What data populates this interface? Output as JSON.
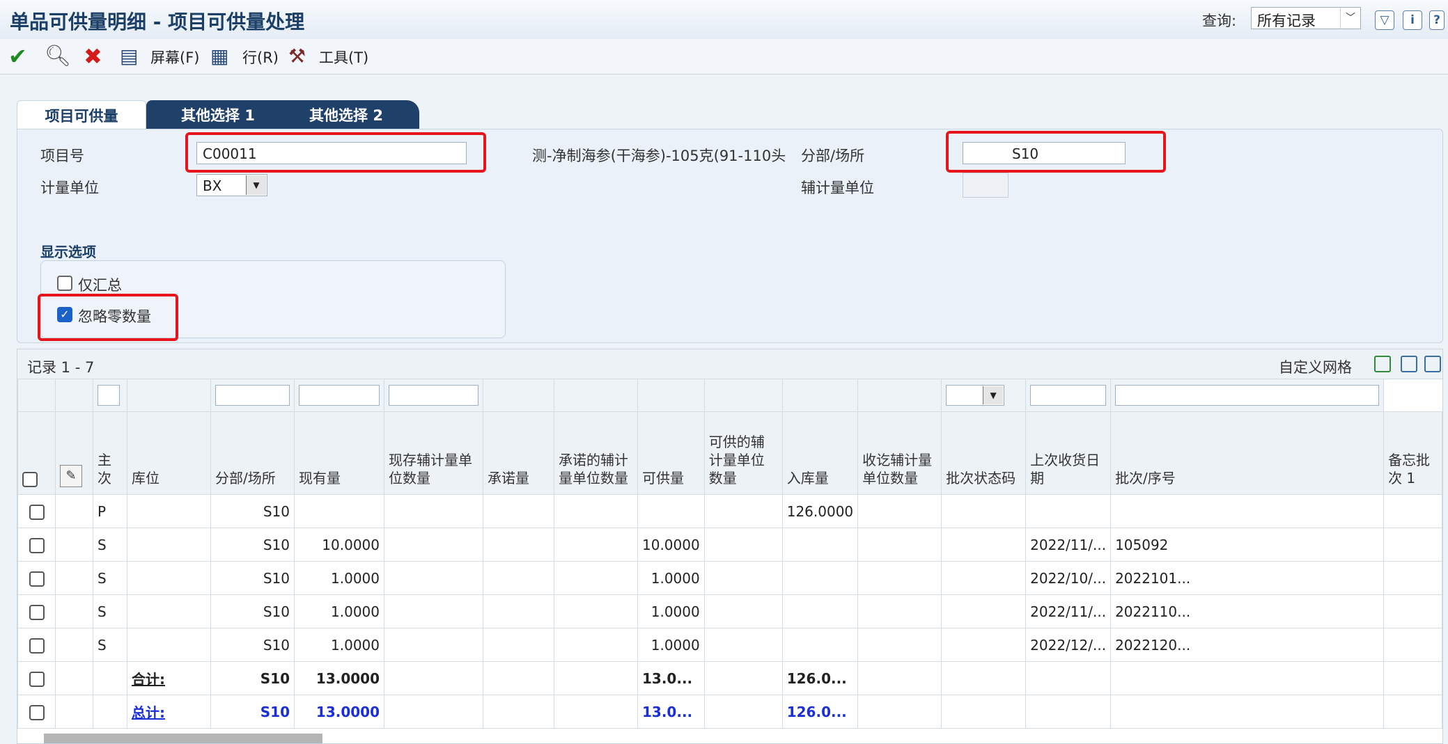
{
  "header": {
    "title": "单品可供量明细 - 项目可供量处理",
    "query_label": "查询:",
    "query_value": "所有记录"
  },
  "toolbar": {
    "screen_label": "屏幕(F)",
    "row_label": "行(R)",
    "tools_label": "工具(T)"
  },
  "tabs": [
    "项目可供量",
    "其他选择 1",
    "其他选择 2"
  ],
  "form": {
    "item_no_label": "项目号",
    "item_no_value": "C00011",
    "item_desc": "测-净制海参(干海参)-105克(91-110头",
    "uom_label": "计量单位",
    "uom_value": "BX",
    "branch_label": "分部/场所",
    "branch_value": "S10",
    "sec_uom_label": "辅计量单位",
    "display_options_title": "显示选项",
    "summary_only_label": "仅汇总",
    "summary_only_checked": false,
    "ignore_zero_label": "忽略零数量",
    "ignore_zero_checked": true
  },
  "grid": {
    "records_label": "记录 1 - 7",
    "custom_grid_label": "自定义网格",
    "columns": [
      "主次",
      "库位",
      "分部/场所",
      "现有量",
      "现存辅计量单位数量",
      "承诺量",
      "承诺的辅计量单位数量",
      "可供量",
      "可供的辅计量单位数量",
      "入库量",
      "收讫辅计量单位数量",
      "批次状态码",
      "上次收货日期",
      "批次/序号",
      "备忘批次 1"
    ],
    "rows": [
      {
        "type": "P",
        "loc": "",
        "branch": "S10",
        "onhand": "",
        "committed": "",
        "avail": "",
        "inbound": "126.0000",
        "lastdate": "",
        "lot": ""
      },
      {
        "type": "S",
        "loc": "",
        "branch": "S10",
        "onhand": "10.0000",
        "committed": "",
        "avail": "10.0000",
        "inbound": "",
        "lastdate": "2022/11/...",
        "lot": "105092"
      },
      {
        "type": "S",
        "loc": "",
        "branch": "S10",
        "onhand": "1.0000",
        "committed": "",
        "avail": "1.0000",
        "inbound": "",
        "lastdate": "2022/10/...",
        "lot": "2022101..."
      },
      {
        "type": "S",
        "loc": "",
        "branch": "S10",
        "onhand": "1.0000",
        "committed": "",
        "avail": "1.0000",
        "inbound": "",
        "lastdate": "2022/11/...",
        "lot": "2022110..."
      },
      {
        "type": "S",
        "loc": "",
        "branch": "S10",
        "onhand": "1.0000",
        "committed": "",
        "avail": "1.0000",
        "inbound": "",
        "lastdate": "2022/12/...",
        "lot": "2022120..."
      }
    ],
    "subtotal": {
      "label": "合计:",
      "branch": "S10",
      "onhand": "13.0000",
      "avail": "13.0...",
      "inbound": "126.0..."
    },
    "total": {
      "label": "总计:",
      "branch": "S10",
      "onhand": "13.0000",
      "avail": "13.0...",
      "inbound": "126.0..."
    }
  },
  "colors": {
    "accent": "#1b3f66",
    "highlight": "#e8141b",
    "total_text": "#1a2fd6",
    "tab_dark": "#1f4068"
  }
}
